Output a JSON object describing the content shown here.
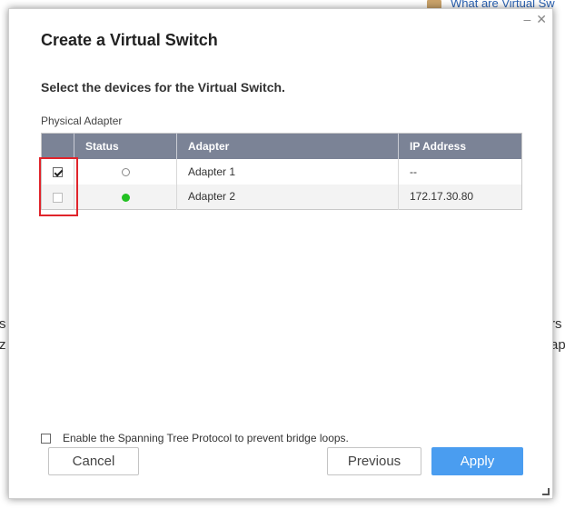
{
  "background": {
    "help_link": "What are Virtual Sw",
    "frag_left_1": "s",
    "frag_left_2": "z",
    "frag_right_1": "rs",
    "frag_right_2": "ap"
  },
  "dialog": {
    "title": "Create a Virtual Switch",
    "subtitle": "Select the devices for the Virtual Switch.",
    "section_label": "Physical Adapter",
    "window_controls": {
      "minimize": "–",
      "close": "✕"
    }
  },
  "table": {
    "headers": {
      "check": "",
      "status": "Status",
      "adapter": "Adapter",
      "ip": "IP Address"
    },
    "rows": [
      {
        "checked": true,
        "status": "offline",
        "adapter": "Adapter 1",
        "ip": "--"
      },
      {
        "checked": false,
        "status": "online",
        "adapter": "Adapter 2",
        "ip": "172.17.30.80"
      }
    ]
  },
  "stp": {
    "checked": false,
    "label": "Enable the Spanning Tree Protocol to prevent bridge loops."
  },
  "buttons": {
    "cancel": "Cancel",
    "previous": "Previous",
    "apply": "Apply"
  },
  "colors": {
    "header_bg": "#7b8396",
    "primary": "#4a9df0",
    "status_online": "#23c123",
    "highlight": "#e0242b"
  }
}
